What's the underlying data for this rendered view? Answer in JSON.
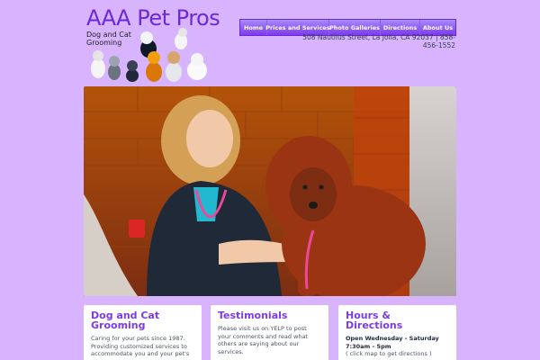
{
  "header": {
    "title": "AAA Pet Pros",
    "tagline": "Dog and Cat Grooming",
    "address": "508 Nautilus Street, La Jolla, CA 92037 | 858-456-1552"
  },
  "nav": {
    "items": [
      {
        "label": "Home"
      },
      {
        "label": "Prices and Services"
      },
      {
        "label": "Photo Galleries"
      },
      {
        "label": "Directions"
      },
      {
        "label": "About Us"
      }
    ]
  },
  "cards": [
    {
      "title": "Dog and Cat Grooming",
      "text": "Caring for your pets since 1987. Providing customized services to accommodate you and your pet's"
    },
    {
      "title": "Testimonials",
      "text": "Please visit us on YELP to post your comments and read what others are saying about our services."
    },
    {
      "title": "Hours & Directions",
      "hours": "Open Wednesday - Saturday 7:30am - 5pm",
      "link": "( click map to get directions )"
    }
  ],
  "colors": {
    "background": "#d8b4fe",
    "accent": "#7c3aed",
    "nav": "#8b5cf6"
  }
}
